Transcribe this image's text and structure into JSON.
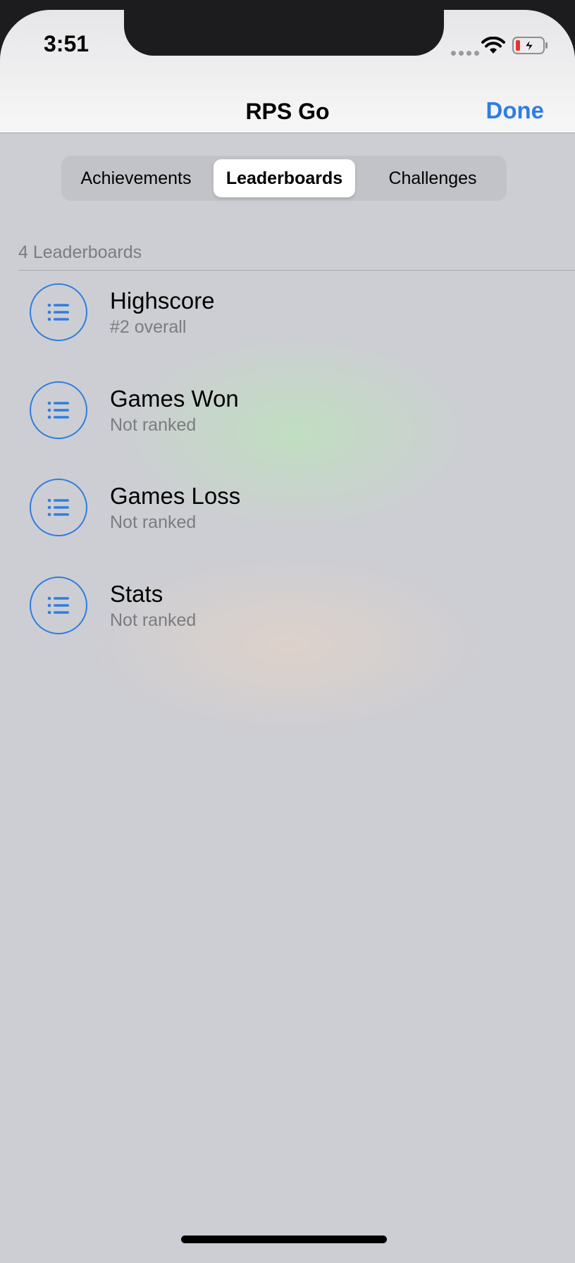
{
  "status_bar": {
    "time": "3:51"
  },
  "nav": {
    "title": "RPS Go",
    "done_label": "Done"
  },
  "tabs": [
    {
      "label": "Achievements",
      "selected": false
    },
    {
      "label": "Leaderboards",
      "selected": true
    },
    {
      "label": "Challenges",
      "selected": false
    }
  ],
  "section": {
    "header": "4 Leaderboards"
  },
  "leaderboards": [
    {
      "icon": "list-icon",
      "title": "Highscore",
      "subtitle": "#2 overall"
    },
    {
      "icon": "list-icon",
      "title": "Games Won",
      "subtitle": "Not ranked"
    },
    {
      "icon": "list-icon",
      "title": "Games Loss",
      "subtitle": "Not ranked"
    },
    {
      "icon": "list-icon",
      "title": "Stats",
      "subtitle": "Not ranked"
    }
  ],
  "colors": {
    "accent": "#2f7de1",
    "battery_low": "#e5352e"
  }
}
